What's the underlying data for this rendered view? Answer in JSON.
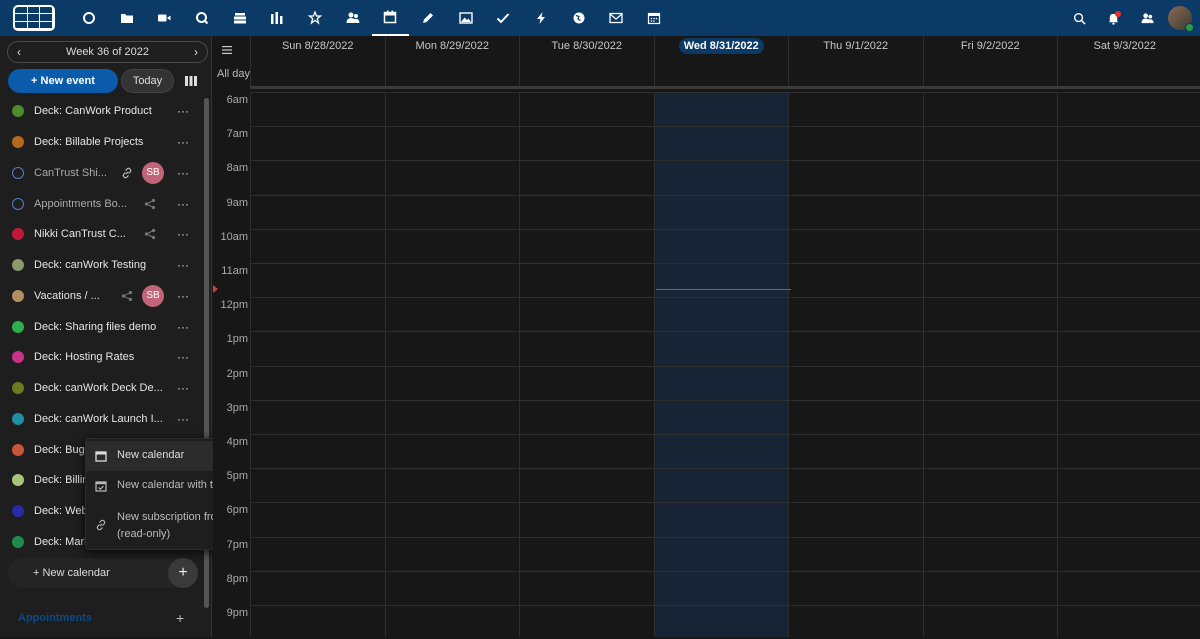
{
  "topbar": {
    "apps": [
      {
        "name": "dashboard",
        "icon": "circle-icon"
      },
      {
        "name": "files",
        "icon": "folder-icon"
      },
      {
        "name": "talk",
        "icon": "video-icon"
      },
      {
        "name": "search",
        "icon": "search-icon"
      },
      {
        "name": "deck-stack",
        "icon": "stack-icon"
      },
      {
        "name": "analytics",
        "icon": "bar-chart-icon"
      },
      {
        "name": "activity",
        "icon": "star-person-icon"
      },
      {
        "name": "contacts",
        "icon": "people-icon"
      },
      {
        "name": "calendar",
        "icon": "calendar-icon",
        "active": true
      },
      {
        "name": "notes",
        "icon": "pencil-icon"
      },
      {
        "name": "photos",
        "icon": "image-icon"
      },
      {
        "name": "tasks",
        "icon": "check-icon"
      },
      {
        "name": "flow",
        "icon": "lightning-icon"
      },
      {
        "name": "maps",
        "icon": "globe-icon"
      },
      {
        "name": "mail",
        "icon": "mail-icon"
      },
      {
        "name": "appointments",
        "icon": "calendar-grid-icon"
      }
    ]
  },
  "sidebar": {
    "week_label": "Week 36 of 2022",
    "new_event_label": "+ New event",
    "today_label": "Today",
    "calendars": [
      {
        "name": "Deck: CanWork Product",
        "color": "#4e8a2e"
      },
      {
        "name": "Deck: Billable Projects",
        "color": "#b6681d"
      },
      {
        "name": "CanTrust Shi...",
        "color": "#4f7ec6",
        "hollow": true,
        "link": true,
        "avatar": "SB"
      },
      {
        "name": "Appointments Bo...",
        "color": "#4f7ec6",
        "hollow": true,
        "share": true
      },
      {
        "name": "Nikki CanTrust C...",
        "color": "#c4183a",
        "share": true
      },
      {
        "name": "Deck: canWork Testing",
        "color": "#8a9a6a"
      },
      {
        "name": "Vacations / ...",
        "color": "#b09060",
        "share": true,
        "avatar": "SB"
      },
      {
        "name": "Deck: Sharing files demo",
        "color": "#2fae4c"
      },
      {
        "name": "Deck: Hosting Rates",
        "color": "#c8338a"
      },
      {
        "name": "Deck: canWork Deck De...",
        "color": "#6e7a1e"
      },
      {
        "name": "Deck: canWork Launch I...",
        "color": "#1e8ea0"
      },
      {
        "name": "Deck: Bug",
        "color": "#c8553a"
      },
      {
        "name": "Deck: Billin",
        "color": "#a9c47a"
      },
      {
        "name": "Deck: Web",
        "color": "#2a2aa8"
      },
      {
        "name": "Deck: Mark",
        "color": "#1e8a4c"
      }
    ],
    "new_calendar_label": "+ New calendar",
    "appointments_label": "Appointments"
  },
  "popup": {
    "items": [
      {
        "label": "New calendar",
        "icon": "calendar-icon"
      },
      {
        "label": "New calendar with task list",
        "icon": "calendar-check-icon"
      },
      {
        "label": "New subscription from link",
        "label2": "(read-only)",
        "icon": "link-icon"
      }
    ]
  },
  "calendar": {
    "days": [
      "Sun 8/28/2022",
      "Mon 8/29/2022",
      "Tue 8/30/2022",
      "Wed 8/31/2022",
      "Thu 9/1/2022",
      "Fri 9/2/2022",
      "Sat 9/3/2022"
    ],
    "today_index": 3,
    "all_day_label": "All day",
    "hours": [
      "6am",
      "7am",
      "8am",
      "9am",
      "10am",
      "11am",
      "12pm",
      "1pm",
      "2pm",
      "3pm",
      "4pm",
      "5pm",
      "6pm",
      "7pm",
      "8pm",
      "9pm"
    ]
  }
}
